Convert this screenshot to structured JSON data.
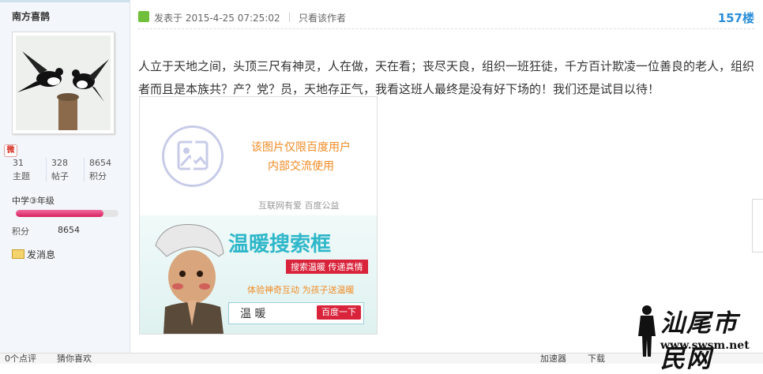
{
  "user": {
    "name": "南方喜鹊",
    "stats": [
      {
        "value": "31",
        "label": "主题"
      },
      {
        "value": "328",
        "label": "帖子"
      },
      {
        "value": "8654",
        "label": "积分"
      }
    ],
    "level_text": "中学③年级",
    "level_progress": 0.85,
    "credit_label": "积分",
    "credit_value": "8654",
    "send_message": "发消息"
  },
  "post": {
    "posted_at": "发表于 2015-4-25 07:25:02",
    "only_author": "只看该作者",
    "floor": "157楼",
    "content": "人立于天地之间，头顶三尺有神灵，人在做，天在看；丧尽天良，组织一班狂徒，千方百计欺凌一位善良的老人，组织者而且是本族共？产？党？员，天地存正气，我看这班人最终是没有好下场的！我们还是试目以待！"
  },
  "image_ad": {
    "notice_line1": "该图片仅限百度用户",
    "notice_line2": "内部交流使用",
    "footer": "互联网有爱  百度公益",
    "campaign_title": "温暖搜索框",
    "ribbon": "搜索温暖 传递真情",
    "slogan": "体验神奇互动  为孩子送温暖",
    "search_text": "温 暖",
    "search_button": "百度一下"
  },
  "bottom_bar": {
    "item1": "0个点评",
    "item2": "猜你喜欢",
    "item3": "加速器",
    "item4": "下载"
  },
  "watermark": {
    "text": "汕尾市民网",
    "url": "www.swsm.net"
  },
  "colors": {
    "floor": "#2b8ed8",
    "level_bar": "#d8225f",
    "notice": "#f08b25",
    "campaign": "#2fb7c9",
    "ribbon": "#d8233a"
  }
}
